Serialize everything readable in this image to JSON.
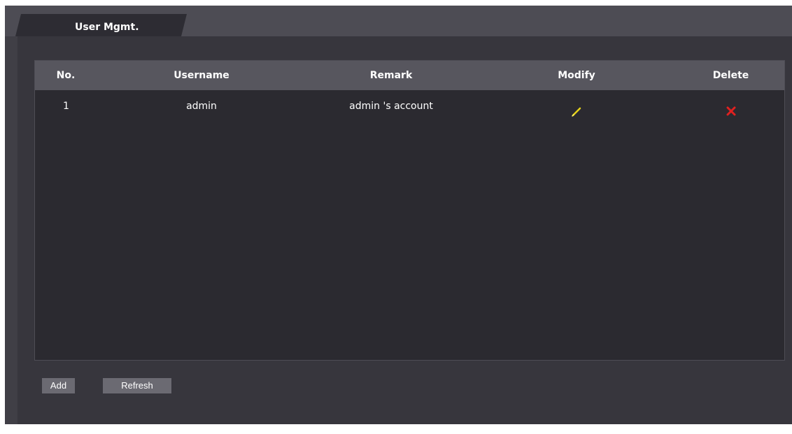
{
  "tabs": [
    {
      "label": "User Mgmt."
    }
  ],
  "table": {
    "headers": {
      "no": "No.",
      "username": "Username",
      "remark": "Remark",
      "modify": "Modify",
      "delete": "Delete"
    },
    "rows": [
      {
        "no": "1",
        "username": "admin",
        "remark": "admin 's account",
        "modify_icon": "pencil-icon",
        "delete_icon": "close-icon"
      }
    ]
  },
  "buttons": {
    "add": "Add",
    "refresh": "Refresh"
  },
  "colors": {
    "background": "#403f46",
    "header": "#57565e",
    "table": "#2b2a30",
    "edit_icon": "#e6d21a",
    "delete_icon": "#e02020"
  }
}
